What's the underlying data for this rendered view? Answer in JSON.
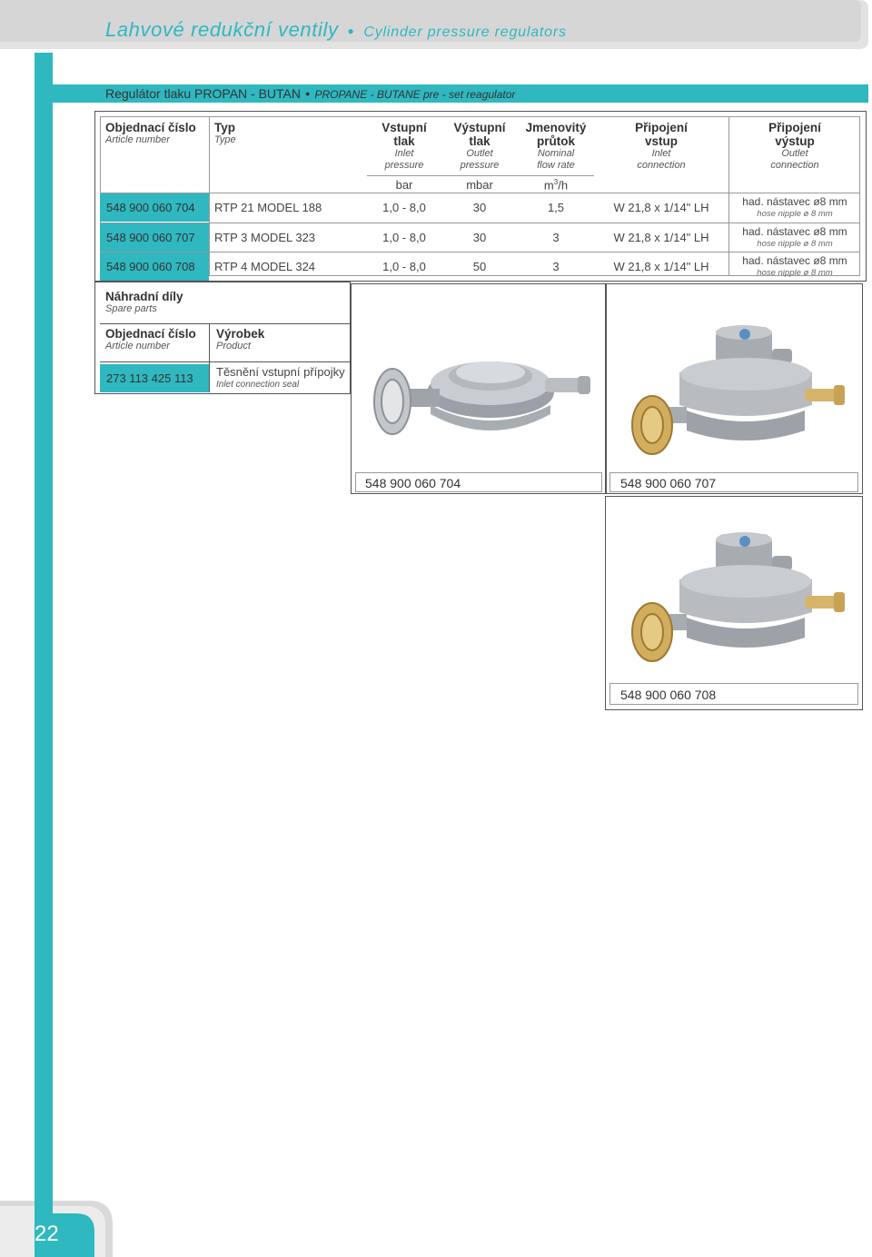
{
  "header": {
    "title_cz": "Lahvové redukční ventily",
    "title_en": "Cylinder pressure regulators"
  },
  "section": {
    "title_cz": "Regulátor tlaku PROPAN - BUTAN",
    "title_en": "PROPANE - BUTANE pre - set reagulator"
  },
  "table": {
    "headers": {
      "article_cz": "Objednací číslo",
      "article_en": "Article number",
      "type_cz": "Typ",
      "type_en": "Type",
      "inlet_cz_1": "Vstupní",
      "inlet_cz_2": "tlak",
      "inlet_en_1": "Inlet",
      "inlet_en_2": "pressure",
      "outlet_cz_1": "Výstupní",
      "outlet_cz_2": "tlak",
      "outlet_en_1": "Outlet",
      "outlet_en_2": "pressure",
      "flow_cz_1": "Jmenovitý",
      "flow_cz_2": "průtok",
      "flow_en_1": "Nominal",
      "flow_en_2": "flow rate",
      "inconn_cz_1": "Připojení",
      "inconn_cz_2": "vstup",
      "inconn_en_1": "Inlet",
      "inconn_en_2": "connection",
      "outconn_cz_1": "Připojení",
      "outconn_cz_2": "výstup",
      "outconn_en_1": "Outlet",
      "outconn_en_2": "connection"
    },
    "units": {
      "inlet": "bar",
      "outlet": "mbar",
      "flow": "m",
      "flow_sup": "3",
      "flow_tail": "/h"
    },
    "rows": [
      {
        "article": "548 900 060 704",
        "type": "RTP 21 MODEL 188",
        "inlet": "1,0 - 8,0",
        "outlet": "30",
        "flow": "1,5",
        "inconn": "W 21,8 x 1/14\" LH",
        "outconn_cz": "had. nástavec ø8 mm",
        "outconn_en": "hose nipple ø 8 mm"
      },
      {
        "article": "548 900 060 707",
        "type": "RTP 3 MODEL 323",
        "inlet": "1,0 - 8,0",
        "outlet": "30",
        "flow": "3",
        "inconn": "W 21,8 x 1/14\" LH",
        "outconn_cz": "had. nástavec ø8 mm",
        "outconn_en": "hose nipple ø 8 mm"
      },
      {
        "article": "548 900 060 708",
        "type": "RTP 4 MODEL 324",
        "inlet": "1,0 - 8,0",
        "outlet": "50",
        "flow": "3",
        "inconn": "W 21,8 x 1/14\" LH",
        "outconn_cz": "had. nástavec ø8 mm",
        "outconn_en": "hose nipple ø 8 mm"
      }
    ]
  },
  "spare": {
    "title_cz": "Náhradní díly",
    "title_en": "Spare parts",
    "article_cz": "Objednací číslo",
    "article_en": "Article number",
    "product_cz": "Výrobek",
    "product_en": "Product",
    "rows": [
      {
        "article": "273 113 425 113",
        "product_cz": "Těsnění vstupní přípojky",
        "product_en": "Inlet connection seal"
      }
    ]
  },
  "photos": [
    {
      "caption": "548 900 060 704"
    },
    {
      "caption": "548 900 060 707"
    },
    {
      "caption": "548 900 060 708"
    }
  ],
  "page_number": "22",
  "colors": {
    "accent": "#2fb8c0",
    "header_gray": "#dcdcdc"
  }
}
